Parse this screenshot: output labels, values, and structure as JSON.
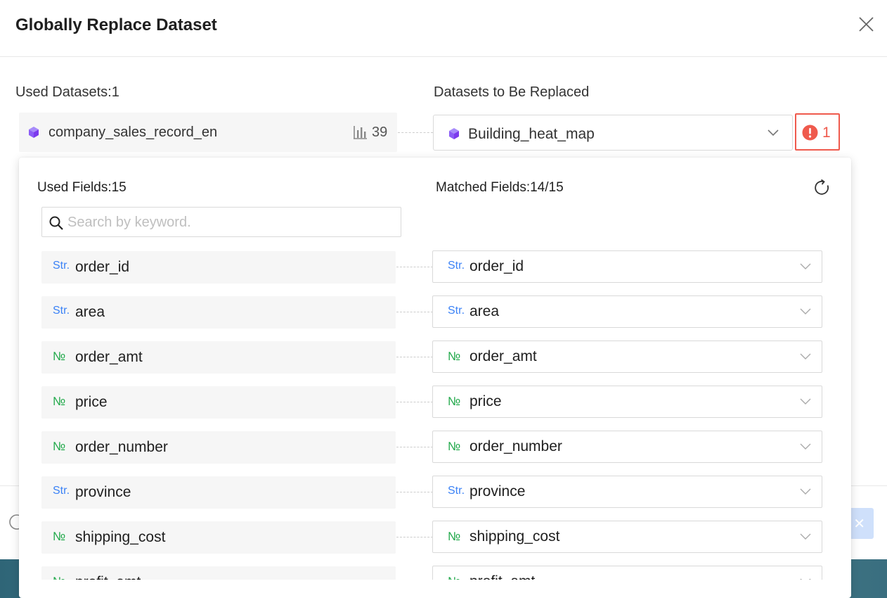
{
  "dialog": {
    "title": "Globally Replace Dataset"
  },
  "used_datasets": {
    "label": "Used Datasets:1",
    "dataset_name": "company_sales_record_en",
    "usage_count": "39"
  },
  "replace": {
    "label": "Datasets to Be Replaced",
    "selected_dataset": "Building_heat_map",
    "warning_count": "1"
  },
  "fields_panel": {
    "used_label": "Used Fields:15",
    "matched_label": "Matched Fields:14/15",
    "search_placeholder": "Search by keyword.",
    "search_value": "",
    "fields": [
      {
        "type": "Str.",
        "kind": "str",
        "source": "order_id",
        "target": "order_id"
      },
      {
        "type": "Str.",
        "kind": "str",
        "source": "area",
        "target": "area"
      },
      {
        "type": "№",
        "kind": "num",
        "source": "order_amt",
        "target": "order_amt"
      },
      {
        "type": "№",
        "kind": "num",
        "source": "price",
        "target": "price"
      },
      {
        "type": "№",
        "kind": "num",
        "source": "order_number",
        "target": "order_number"
      },
      {
        "type": "Str.",
        "kind": "str",
        "source": "province",
        "target": "province"
      },
      {
        "type": "№",
        "kind": "num",
        "source": "shipping_cost",
        "target": "shipping_cost"
      },
      {
        "type": "№",
        "kind": "num",
        "source": "profit_amt",
        "target": "profit_amt"
      }
    ]
  },
  "colors": {
    "accent": "#3b82f6",
    "number_type": "#22a94b",
    "warning": "#ef5a4d",
    "dataset_icon": "#8b5cf6"
  }
}
